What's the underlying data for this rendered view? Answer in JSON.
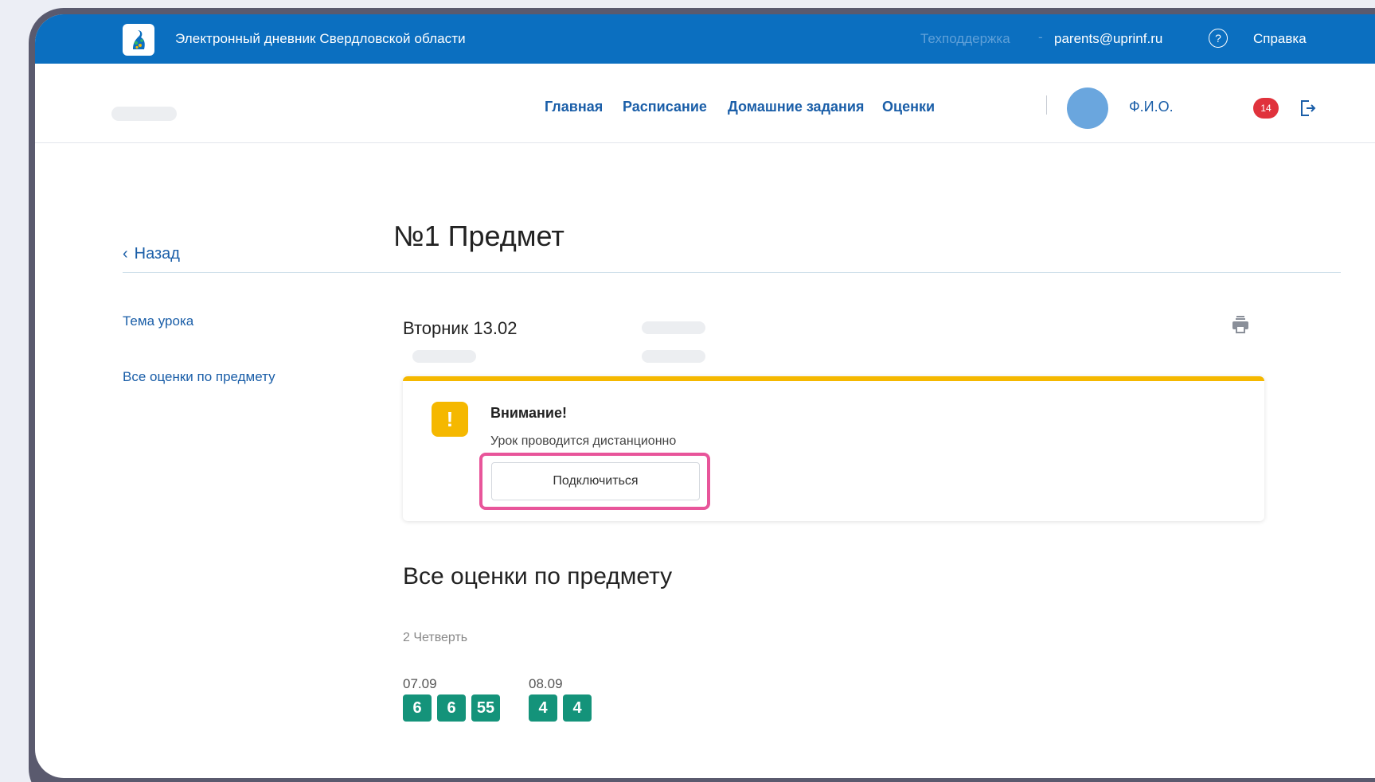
{
  "topbar": {
    "title": "Электронный дневник Свердловской области",
    "support_label": "Техподдержка",
    "separator": "-",
    "email": "parents@uprinf.ru",
    "help_icon_glyph": "?",
    "help_label": "Справка"
  },
  "nav": {
    "items": [
      "Главная",
      "Расписание",
      "Домашние задания",
      "Оценки"
    ],
    "user_name": "Ф.И.О.",
    "notification_count": "14"
  },
  "page": {
    "back_label": "Назад",
    "title": "№1 Предмет",
    "sidebar": [
      "Тема урока",
      "Все оценки по предмету"
    ]
  },
  "lesson": {
    "date": "Вторник 13.02"
  },
  "alert": {
    "icon_glyph": "!",
    "title": "Внимание!",
    "text": "Урок проводится дистанционно",
    "button_label": "Подключиться"
  },
  "grades": {
    "heading": "Все оценки по предмету",
    "quarter": "2 Четверть",
    "groups": [
      {
        "date": "07.09",
        "marks": [
          "6",
          "6",
          "55"
        ]
      },
      {
        "date": "08.09",
        "marks": [
          "4",
          "4"
        ]
      }
    ]
  },
  "colors": {
    "topbar": "#0b6fc0",
    "link": "#1a5ea8",
    "warning": "#f5b800",
    "grade": "#14937a",
    "highlight": "#e8559a",
    "badge": "#e0323c"
  }
}
